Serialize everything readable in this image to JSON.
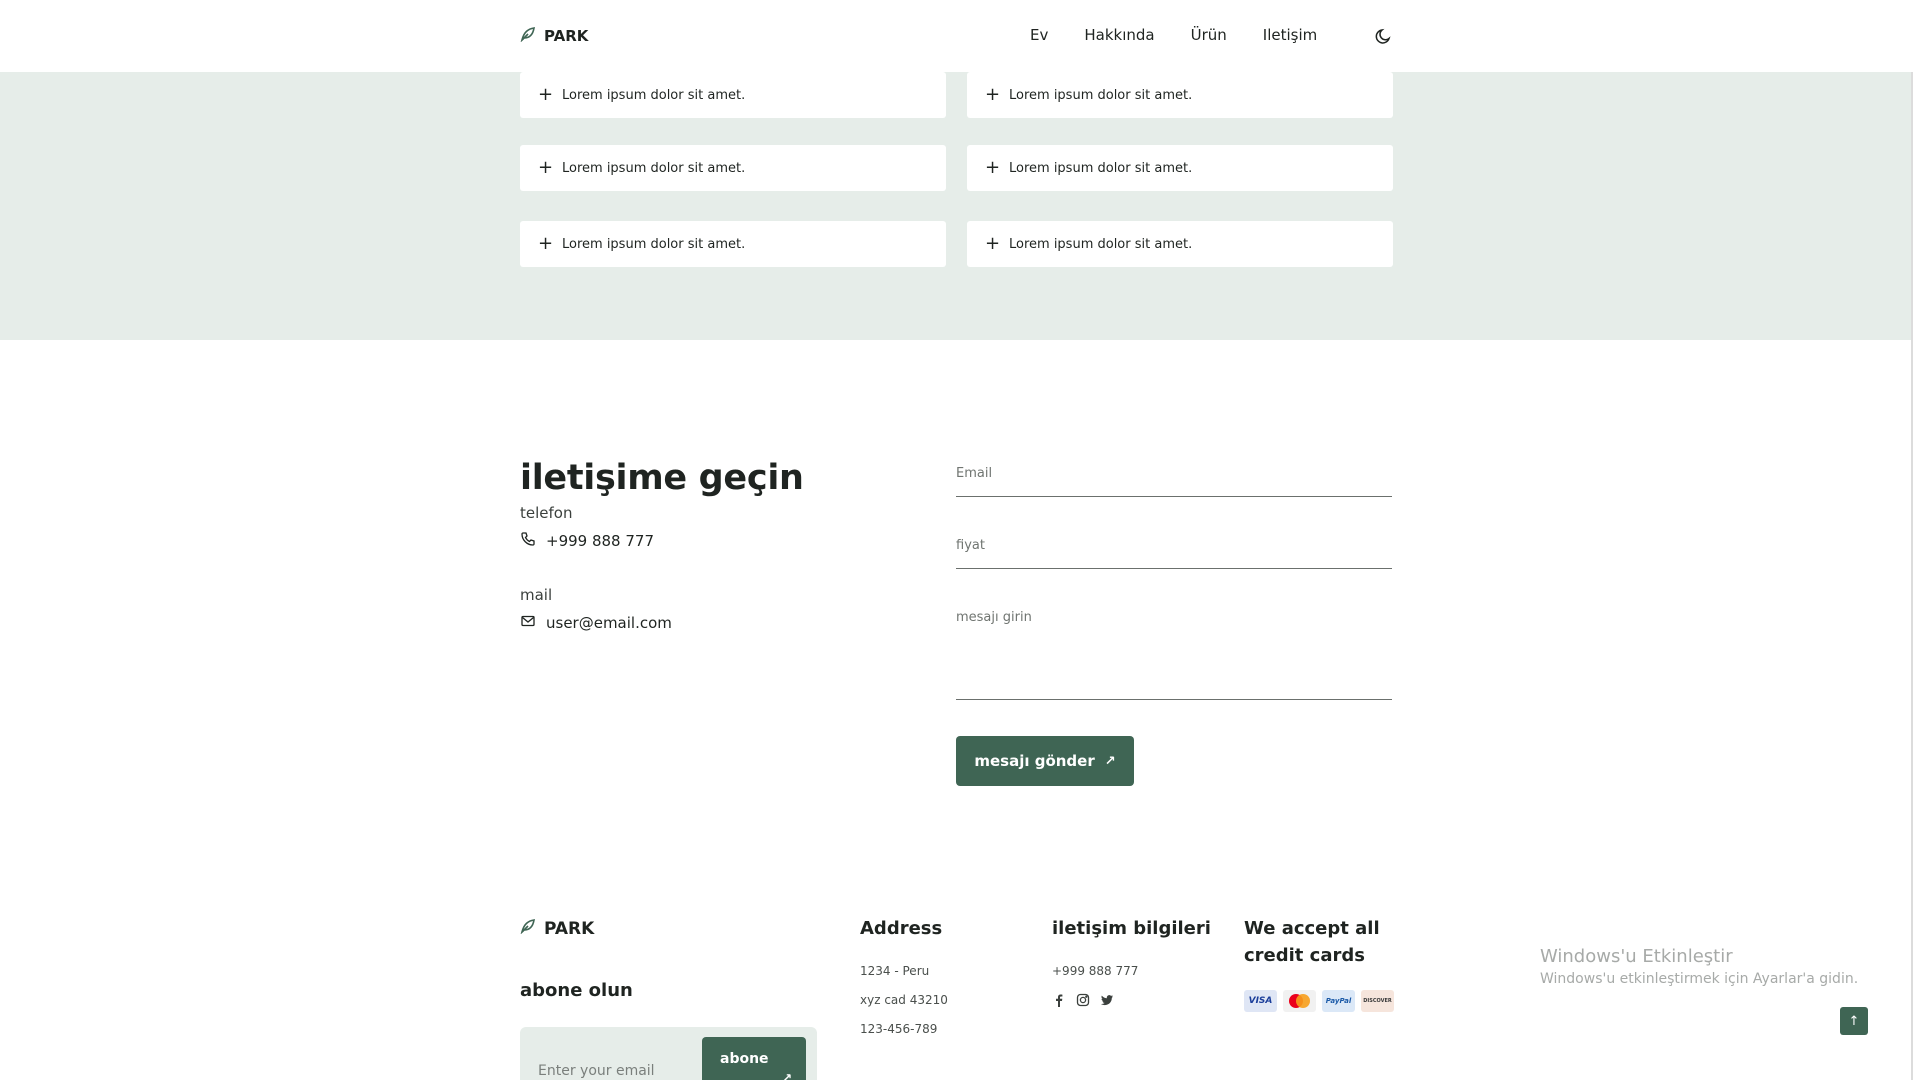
{
  "nav": {
    "brand": "PARK",
    "links": [
      "Ev",
      "Hakkında",
      "Ürün",
      "Iletişim"
    ]
  },
  "faq": {
    "items": [
      "Lorem ipsum dolor sit amet.",
      "Lorem ipsum dolor sit amet.",
      "Lorem ipsum dolor sit amet.",
      "Lorem ipsum dolor sit amet.",
      "Lorem ipsum dolor sit amet.",
      "Lorem ipsum dolor sit amet."
    ]
  },
  "contact": {
    "title": "iletişime geçin",
    "phone_label": "telefon",
    "phone_value": "+999 888 777",
    "mail_label": "mail",
    "mail_value": "user@email.com",
    "form": {
      "email_placeholder": "Email",
      "price_placeholder": "fiyat",
      "message_placeholder": "mesajı girin",
      "send_label": "mesajı gönder"
    }
  },
  "footer": {
    "brand": "PARK",
    "subscribe_title": "abone olun",
    "subscribe_placeholder": "Enter your email",
    "subscribe_button": "abone",
    "address_title": "Address",
    "address_lines": [
      "1234 - Peru",
      "xyz cad 43210",
      "123-456-789"
    ],
    "info_title": "iletişim bilgileri",
    "info_phone": "+999 888 777",
    "cards_title": "We accept all credit cards",
    "cards": [
      "VISA",
      "mastercard",
      "PayPal",
      "DISCOVER"
    ]
  },
  "windows_watermark": {
    "title": "Windows'u Etkinleştir",
    "subtitle": "Windows'u etkinleştirmek için Ayarlar'a gidin."
  },
  "colors": {
    "accent": "#3f6554",
    "section_bg": "#e6ede9"
  }
}
